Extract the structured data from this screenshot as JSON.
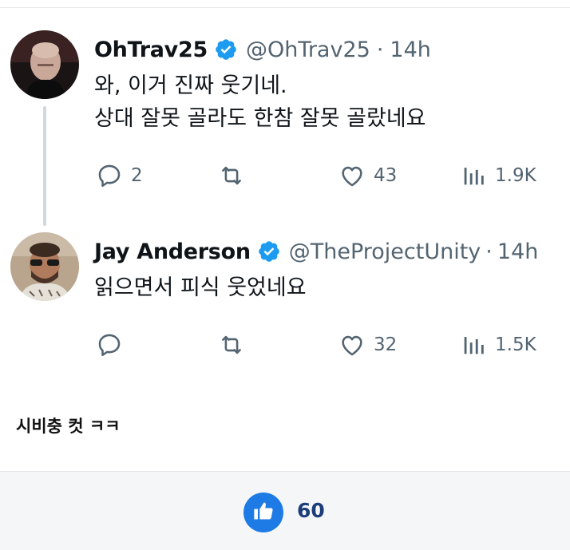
{
  "tweets": [
    {
      "name": "OhTrav25",
      "handle": "@OhTrav25",
      "separator": "·",
      "time": "14h",
      "lines": [
        "와, 이거 진짜 웃기네.",
        "상대 잘못 골라도 한참 잘못 골랐네요"
      ],
      "replies": "2",
      "retweets": "",
      "likes": "43",
      "views": "1.9K"
    },
    {
      "name": "Jay Anderson",
      "handle": "@TheProjectUnity",
      "separator": "·",
      "time": "14h",
      "lines": [
        "읽으면서 피식 웃었네요"
      ],
      "replies": "",
      "retweets": "",
      "likes": "32",
      "views": "1.5K"
    }
  ],
  "caption": "시비충 컷 ㅋㅋ",
  "footer": {
    "like_count": "60"
  },
  "colors": {
    "verified": "#1d9bf0",
    "muted": "#536471",
    "like_button": "#1e7be6"
  },
  "icons": [
    "verified-badge-icon",
    "reply-icon",
    "retweet-icon",
    "like-icon",
    "views-icon",
    "thumbs-up-icon"
  ]
}
